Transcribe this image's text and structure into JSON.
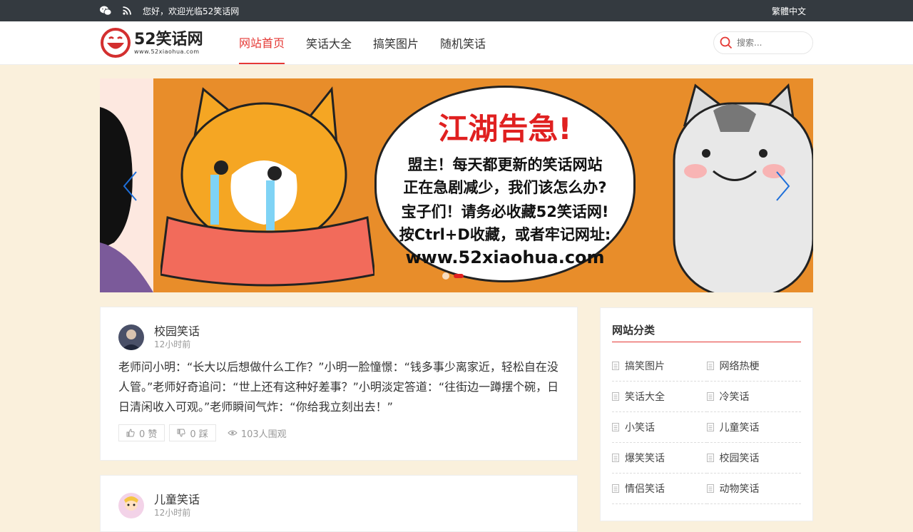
{
  "topbar": {
    "welcome": "您好，欢迎光临52笑话网",
    "lang_switch": "繁體中文"
  },
  "header": {
    "logo_main": "52笑话网",
    "logo_sub": "www.52xiaohua.com",
    "nav": [
      {
        "label": "网站首页",
        "active": true
      },
      {
        "label": "笑话大全",
        "active": false
      },
      {
        "label": "搞笑图片",
        "active": false
      },
      {
        "label": "随机笑话",
        "active": false
      }
    ],
    "search_placeholder": "搜索..."
  },
  "banner": {
    "title": "江湖告急!",
    "line1": "盟主！每天都更新的笑话网站",
    "line2": "正在急剧减少，我们该怎么办?",
    "line3": "宝子们！请务必收藏52笑话网!",
    "line4": "按Ctrl+D收藏，或者牢记网址:",
    "url": "www.52xiaohua.com",
    "slide_index": 1,
    "slide_count": 2
  },
  "posts": [
    {
      "category": "校园笑话",
      "time": "12小时前",
      "content": "老师问小明：“长大以后想做什么工作？”小明一脸憧憬：“钱多事少离家近，轻松自在没人管。”老师好奇追问：“世上还有这种好差事？”小明淡定答道：“往街边一蹲摆个碗，日日清闲收入可观。”老师瞬间气炸：“你给我立刻出去！”",
      "likes": "0 赞",
      "dislikes": "0 踩",
      "views": "103人围观"
    },
    {
      "category": "儿童笑话",
      "time": "12小时前"
    }
  ],
  "sidebar": {
    "title": "网站分类",
    "categories": [
      "搞笑图片",
      "网络热梗",
      "笑话大全",
      "冷笑话",
      "小笑话",
      "儿童笑话",
      "爆笑笑话",
      "校园笑话",
      "情侣笑话",
      "动物笑话"
    ]
  },
  "colors": {
    "accent": "#e53935",
    "topbar_bg": "#343a40",
    "page_bg": "#faf0dc"
  }
}
